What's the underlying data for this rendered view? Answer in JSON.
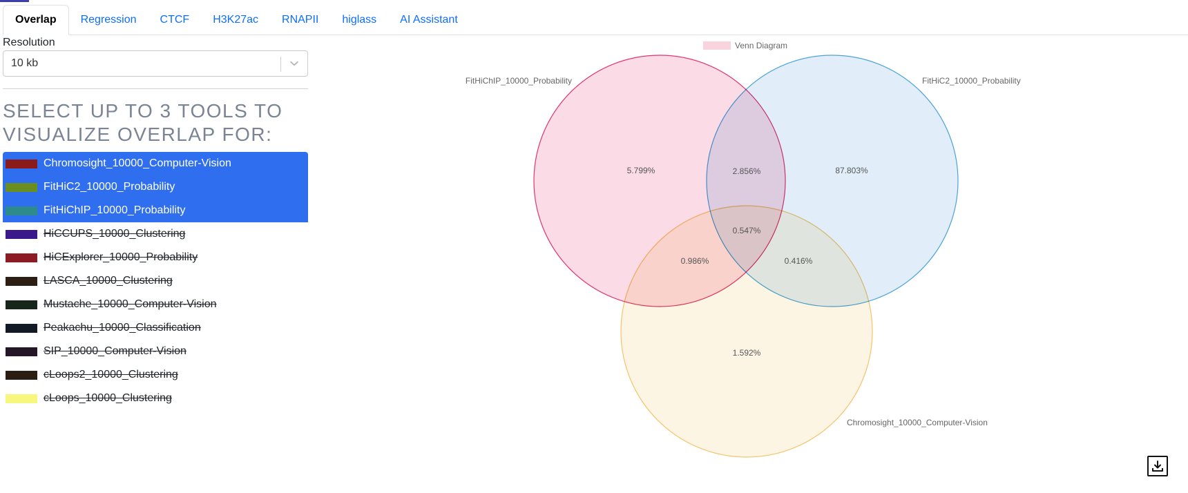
{
  "tabs": [
    {
      "label": "Overlap",
      "active": true
    },
    {
      "label": "Regression",
      "active": false
    },
    {
      "label": "CTCF",
      "active": false
    },
    {
      "label": "H3K27ac",
      "active": false
    },
    {
      "label": "RNAPII",
      "active": false
    },
    {
      "label": "higlass",
      "active": false
    },
    {
      "label": "AI Assistant",
      "active": false
    }
  ],
  "resolution": {
    "label": "Resolution",
    "value": "10 kb",
    "icon": "chevron-down-icon"
  },
  "tools_heading": "SELECT UP TO 3 TOOLS TO VISUALIZE OVERLAP FOR:",
  "tools": [
    {
      "label": "Chromosight_10000_Computer-Vision",
      "color": "#8b1a1a",
      "selected": true
    },
    {
      "label": "FitHiC2_10000_Probability",
      "color": "#6b8e23",
      "selected": true
    },
    {
      "label": "FitHiChIP_10000_Probability",
      "color": "#2e8b8b",
      "selected": true
    },
    {
      "label": "HiCCUPS_10000_Clustering",
      "color": "#3a1a8a",
      "selected": false
    },
    {
      "label": "HiCExplorer_10000_Probability",
      "color": "#8b1c24",
      "selected": false
    },
    {
      "label": "LASCA_10000_Clustering",
      "color": "#2e1f14",
      "selected": false
    },
    {
      "label": "Mustache_10000_Computer-Vision",
      "color": "#16261a",
      "selected": false
    },
    {
      "label": "Peakachu_10000_Classification",
      "color": "#121a26",
      "selected": false
    },
    {
      "label": "SIP_10000_Computer-Vision",
      "color": "#241626",
      "selected": false
    },
    {
      "label": "cLoops2_10000_Clustering",
      "color": "#2a1d12",
      "selected": false
    },
    {
      "label": "cLoops_10000_Clustering",
      "color": "#f7f77e",
      "selected": false
    }
  ],
  "chart_data": {
    "type": "venn",
    "legend": {
      "label": "Venn Diagram",
      "color": "#f9d3de",
      "position": "top-center"
    },
    "sets": [
      {
        "name": "FitHiChIP_10000_Probability",
        "fill": "#fad5e0",
        "stroke": "#e0356b"
      },
      {
        "name": "FitHiC2_10000_Probability",
        "fill": "#dcebf9",
        "stroke": "#4aa3d8"
      },
      {
        "name": "Chromosight_10000_Computer-Vision",
        "fill": "#fdf3df",
        "stroke": "#f3c46b"
      }
    ],
    "regions": [
      {
        "sets": [
          "FitHiChIP_10000_Probability"
        ],
        "label": "5.799%"
      },
      {
        "sets": [
          "FitHiC2_10000_Probability"
        ],
        "label": "87.803%"
      },
      {
        "sets": [
          "Chromosight_10000_Computer-Vision"
        ],
        "label": "1.592%"
      },
      {
        "sets": [
          "FitHiChIP_10000_Probability",
          "FitHiC2_10000_Probability"
        ],
        "label": "2.856%"
      },
      {
        "sets": [
          "FitHiChIP_10000_Probability",
          "Chromosight_10000_Computer-Vision"
        ],
        "label": "0.986%"
      },
      {
        "sets": [
          "FitHiC2_10000_Probability",
          "Chromosight_10000_Computer-Vision"
        ],
        "label": "0.416%"
      },
      {
        "sets": [
          "FitHiChIP_10000_Probability",
          "FitHiC2_10000_Probability",
          "Chromosight_10000_Computer-Vision"
        ],
        "label": "0.547%"
      }
    ]
  },
  "download_icon": "download-icon"
}
